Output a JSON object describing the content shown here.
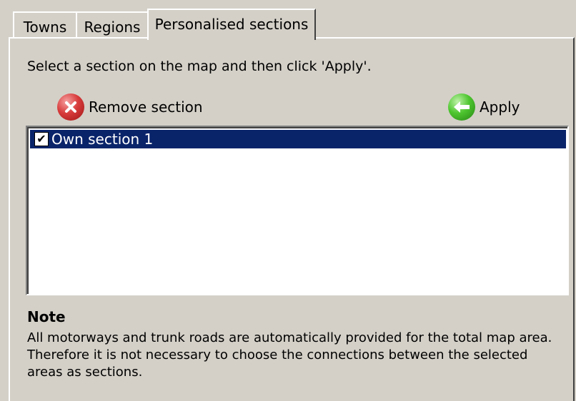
{
  "tabs": [
    {
      "label": "Towns",
      "active": false
    },
    {
      "label": "Regions",
      "active": false
    },
    {
      "label": "Personalised sections",
      "active": true
    }
  ],
  "instruction": "Select a section on the map and then click 'Apply'.",
  "toolbar": {
    "remove_label": "Remove section",
    "remove_icon": "remove-icon",
    "apply_label": "Apply",
    "apply_icon": "apply-arrow-icon"
  },
  "sections": [
    {
      "label": "Own section 1",
      "checked": true,
      "selected": true
    }
  ],
  "note": {
    "title": "Note",
    "text": "All motorways and trunk roads are automatically provided for the total map area. Therefore it is not necessary to choose the connections between the selected areas as sections."
  },
  "colors": {
    "face": "#d4d0c8",
    "selection": "#0a246a",
    "remove": "#d83c3c",
    "apply": "#4ec62f"
  }
}
